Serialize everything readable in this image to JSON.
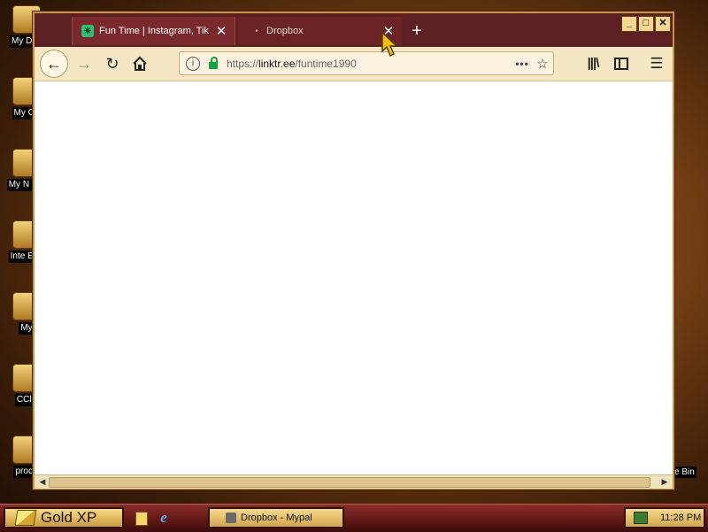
{
  "desktop": {
    "icons": [
      {
        "label": "My Doc"
      },
      {
        "label": "My Co"
      },
      {
        "label": "My N Pla"
      },
      {
        "label": "Inte Exp"
      },
      {
        "label": "My"
      },
      {
        "label": "CCle"
      },
      {
        "label": "proce"
      }
    ],
    "right_icon_label": "e Bin"
  },
  "browser": {
    "tabs": [
      {
        "title": "Fun Time | Instagram, Tik",
        "favicon": "linktree-icon",
        "active": true
      },
      {
        "title": "Dropbox",
        "active": false
      }
    ],
    "new_tab_glyph": "+",
    "window_controls": {
      "minimize": "_",
      "maximize": "□",
      "close": "✕"
    },
    "url_prefix": "https://",
    "url_host": "linktr.ee",
    "url_path": "/funtime1990",
    "url_more": "•••"
  },
  "taskbar": {
    "start_label": "Gold XP",
    "task_button_label": "Dropbox - Mypal",
    "clock": "11:28 PM"
  },
  "colors": {
    "accent": "#5c1f22",
    "taskbar_gold": "#d2a44b",
    "secure_lock": "#12a13b"
  }
}
